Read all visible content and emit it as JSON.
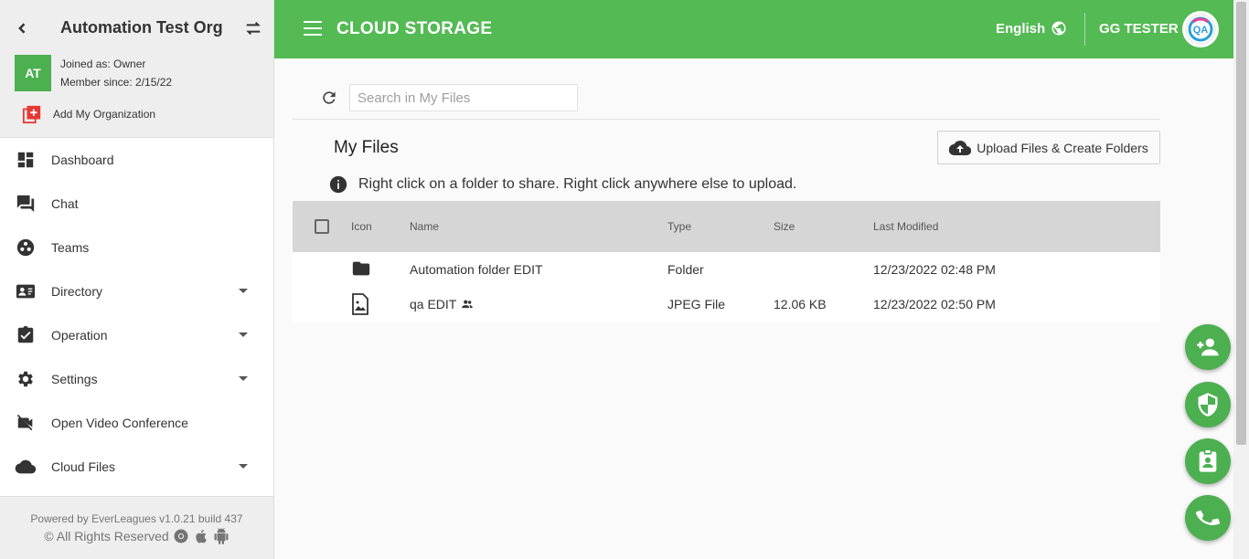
{
  "sidebar": {
    "org_name": "Automation Test Org",
    "avatar_initials": "AT",
    "joined": "Joined as: Owner",
    "member_since": "Member since: 2/15/22",
    "add_org": "Add My Organization",
    "items": [
      {
        "label": "Dashboard",
        "icon": "dashboard-icon",
        "expandable": false
      },
      {
        "label": "Chat",
        "icon": "chat-icon",
        "expandable": false
      },
      {
        "label": "Teams",
        "icon": "teams-icon",
        "expandable": false
      },
      {
        "label": "Directory",
        "icon": "directory-icon",
        "expandable": true
      },
      {
        "label": "Operation",
        "icon": "clipboard-icon",
        "expandable": true
      },
      {
        "label": "Settings",
        "icon": "gear-icon",
        "expandable": true
      },
      {
        "label": "Open Video Conference",
        "icon": "video-icon",
        "expandable": false
      },
      {
        "label": "Cloud Files",
        "icon": "cloud-icon",
        "expandable": true
      }
    ],
    "powered_by": "Powered by EverLeagues v1.0.21 build 437",
    "rights": "© All Rights Reserved"
  },
  "topbar": {
    "title": "CLOUD STORAGE",
    "language": "English",
    "user_name": "GG TESTER",
    "accent": "#54ba54"
  },
  "main": {
    "search_placeholder": "Search in My Files",
    "title": "My Files",
    "upload_label": "Upload Files & Create Folders",
    "info": "Right click on a folder to share. Right click anywhere else to upload.",
    "columns": {
      "icon": "Icon",
      "name": "Name",
      "type": "Type",
      "size": "Size",
      "modified": "Last Modified"
    },
    "rows": [
      {
        "icon": "folder-icon",
        "name": "Automation folder EDIT",
        "type": "Folder",
        "size": "",
        "modified": "12/23/2022 02:48 PM",
        "shared": false
      },
      {
        "icon": "image-file-icon",
        "name": "qa EDIT",
        "type": "JPEG File",
        "size": "12.06 KB",
        "modified": "12/23/2022 02:50 PM",
        "shared": true
      }
    ]
  },
  "fabs": [
    "add-person-icon",
    "shield-icon",
    "badge-icon",
    "phone-icon"
  ]
}
